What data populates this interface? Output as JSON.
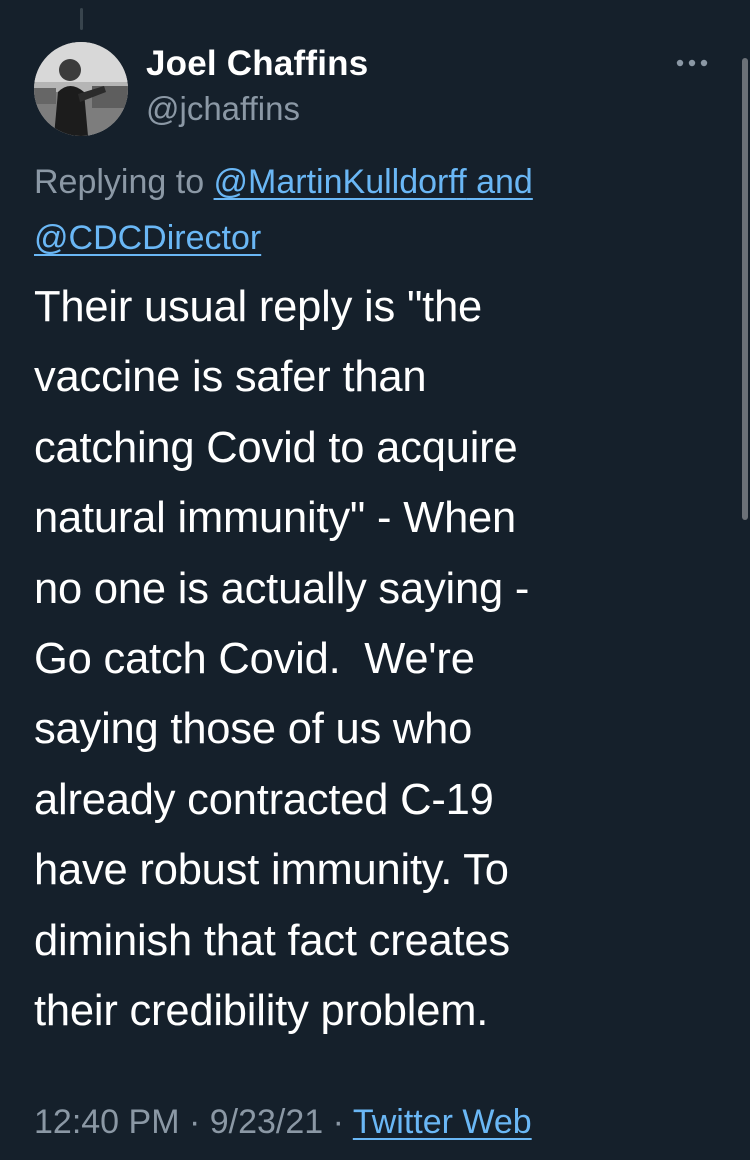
{
  "user": {
    "display_name": "Joel Chaffins",
    "handle": "@jchaffins"
  },
  "more_icon": "more-horizontal-icon",
  "reply": {
    "prefix": "Replying to ",
    "mention_1": "@MartinKulldorff",
    "conjunction": " and",
    "mention_2": "@CDCDirector"
  },
  "tweet": {
    "lines": [
      "Their usual reply is \"the",
      "vaccine is safer than",
      "catching Covid to acquire",
      "natural immunity\" - When",
      "no one is actually saying -",
      "Go catch Covid.  We're",
      "saying those of us who",
      "already contracted C-19",
      "have robust immunity. To",
      "diminish that fact creates",
      "their credibility problem."
    ]
  },
  "meta": {
    "time": "12:40 PM",
    "separator": " · ",
    "date": "9/23/21",
    "source": "Twitter Web"
  },
  "colors": {
    "background": "#15202b",
    "link": "#6ab7f5",
    "secondary_text": "#8b98a5",
    "primary_text": "#ffffff"
  }
}
